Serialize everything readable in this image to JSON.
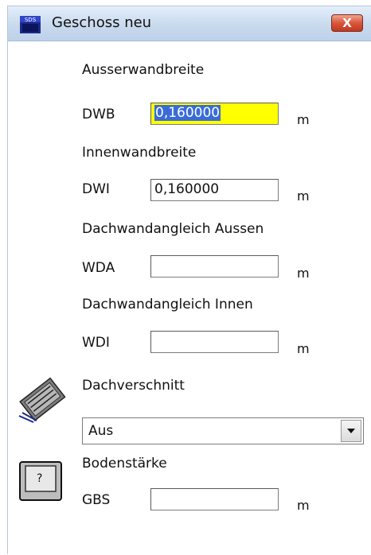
{
  "window": {
    "title": "Geschoss neu",
    "close_label": "X",
    "app_icon_text": "SDS"
  },
  "form": {
    "outer_wall": {
      "section_label": "Ausserwandbreite",
      "code": "DWB",
      "value": "0,160000",
      "unit": "m"
    },
    "inner_wall": {
      "section_label": "Innenwandbreite",
      "code": "DWI",
      "value": "0,160000",
      "unit": "m"
    },
    "roof_wall_outer": {
      "section_label": "Dachwandangleich Aussen",
      "code": "WDA",
      "value": "",
      "unit": "m"
    },
    "roof_wall_inner": {
      "section_label": "Dachwandangleich Innen",
      "code": "WDI",
      "value": "",
      "unit": "m"
    },
    "roof_cut": {
      "section_label": "Dachverschnitt",
      "selected": "Aus",
      "icon": "roof-cut-icon"
    },
    "floor_thickness": {
      "section_label": "Bodenstärke",
      "code": "GBS",
      "value": "",
      "unit": "m",
      "icon": "help-key-icon"
    }
  },
  "colors": {
    "active_field": "#ffff00",
    "selection": "#3a6cd8",
    "close_button": "#d9553c",
    "titlebar": "#c9daee"
  }
}
